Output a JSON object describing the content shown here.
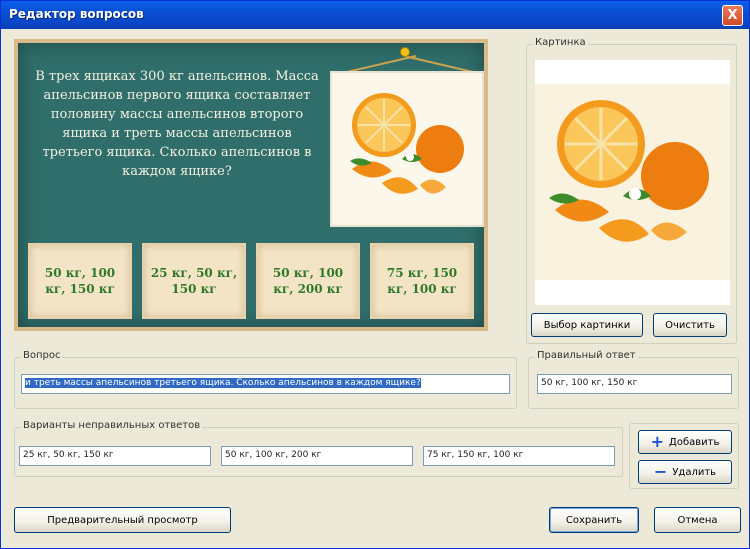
{
  "window": {
    "title": "Редактор вопросов",
    "close_glyph": "X"
  },
  "preview": {
    "question": "В трех ящиках 300 кг апельсинов. Масса апельсинов первого ящика составляет половину массы апельсинов второго ящика и треть массы апельсинов третьего ящика. Сколько апельсинов в каждом ящике?",
    "answers": [
      "50 кг, 100 кг, 150 кг",
      "25 кг, 50 кг, 150 кг",
      "50 кг, 100 кг, 200 кг",
      "75 кг, 150 кг, 100 кг"
    ]
  },
  "image_panel": {
    "label": "Картинка",
    "choose_button": "Выбор картинки",
    "clear_button": "Очистить"
  },
  "question_field": {
    "label": "Вопрос",
    "value": "и треть массы апельсинов третьего ящика. Сколько апельсинов в каждом ящике?"
  },
  "correct_answer": {
    "label": "Правильный ответ",
    "value": "50 кг, 100 кг, 150 кг"
  },
  "wrong_answers": {
    "label": "Варианты неправильных ответов",
    "values": [
      "25 кг, 50 кг, 150 кг",
      "50 кг, 100 кг, 200 кг",
      "75 кг, 150 кг, 100 кг"
    ]
  },
  "side_buttons": {
    "add": "Добавить",
    "remove": "Удалить",
    "add_icon": "plus-icon",
    "remove_icon": "minus-icon"
  },
  "footer": {
    "preview": "Предварительный просмотр",
    "save": "Сохранить",
    "cancel": "Отмена"
  },
  "colors": {
    "board": "#2f6e6b",
    "answer_text": "#2f7a2a",
    "selection": "#316ac5",
    "titlebar": "#0a4fd4"
  }
}
